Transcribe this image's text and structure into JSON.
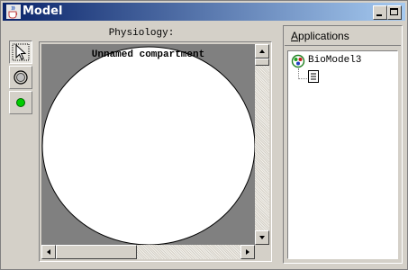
{
  "window": {
    "title": "Model",
    "icon": "java-cup-icon",
    "controls": [
      "minimize-icon",
      "maximize-icon"
    ]
  },
  "toolbar": {
    "tools": [
      {
        "name": "select-tool",
        "icon": "arrow-pointer-icon",
        "active": true
      },
      {
        "name": "compartment-tool",
        "icon": "compartment-circle-icon",
        "active": false
      },
      {
        "name": "species-tool",
        "icon": "green-dot-icon",
        "active": false
      }
    ]
  },
  "physiology": {
    "label": "Physiology:",
    "compartment_name": "Unnamed compartment"
  },
  "applications": {
    "header_underlined": "A",
    "header_rest": "pplications",
    "tree": {
      "root_label": "BioModel3",
      "root_icon": "biomodel-icon",
      "child_icon": "document-icon"
    }
  },
  "colors": {
    "titlebar_start": "#0a246a",
    "titlebar_end": "#a6caf0",
    "canvas_background": "#808080",
    "compartment_fill": "#ffffff",
    "species_green": "#00cc00"
  }
}
